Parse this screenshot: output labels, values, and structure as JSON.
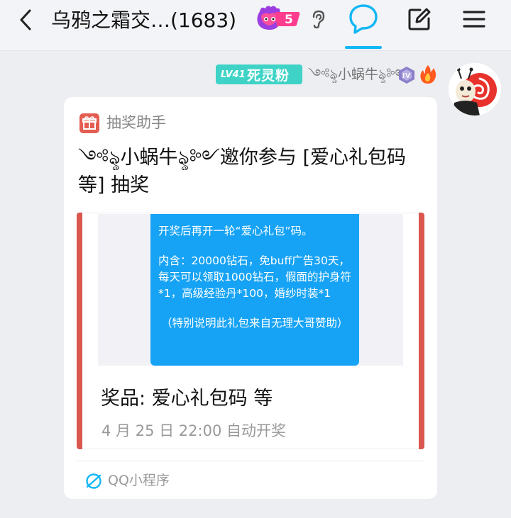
{
  "header": {
    "title": "乌鸦之霜交…(1683)",
    "badge_count": "5",
    "icons": [
      "back-arrow-icon",
      "flame-face-icon",
      "ear-icon",
      "chat-bubble-icon",
      "edit-icon",
      "menu-icon"
    ],
    "accent": "#12b7f5"
  },
  "message": {
    "level_badge": "LV41",
    "title_badge": "死灵粉",
    "sender": "༺ৡ小蜗牛ৡ༻",
    "badge_color": "#3fd3c7",
    "card": {
      "helper": "抽奖助手",
      "headline": "༺ৡ小蜗牛ৡ༻邀你参与 [爱心礼包码等] 抽奖",
      "image_text": [
        "开奖后再开一轮“爱心礼包”码。",
        "内含：20000钻石，免buff广告30天，每天可以领取1000钻石，假面的护身符*1，高级经验丹*100，婚纱时装*1",
        "（特别说明此礼包来自无理大哥赞助）"
      ],
      "prize": "奖品: 爱心礼包码 等",
      "draw_time": "4 月 25 日 22:00 自动开奖",
      "source": "QQ小程序",
      "side_color": "#d9574e",
      "bubble_color": "#17a3f5"
    }
  }
}
